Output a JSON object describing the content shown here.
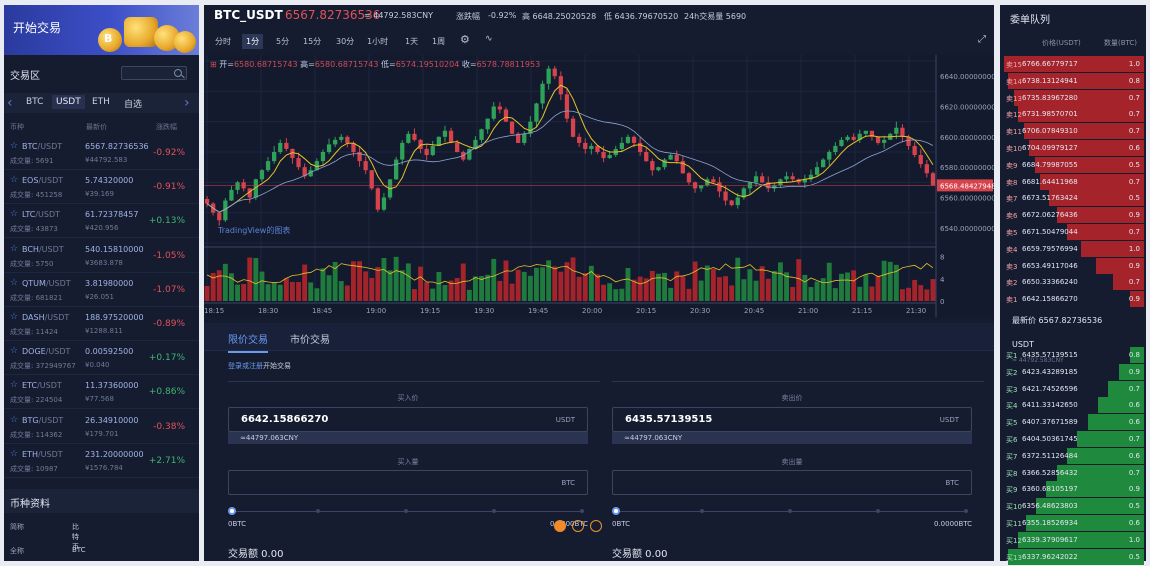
{
  "banner": {
    "button_label": "开始交易",
    "coin_text": "B"
  },
  "market": {
    "title": "交易区",
    "search_placeholder": "",
    "tabs": [
      "BTC",
      "USDT",
      "ETH",
      "自选"
    ],
    "active_tab": "USDT",
    "columns": [
      "币种",
      "最新价",
      "涨跌幅"
    ],
    "rows": [
      {
        "base": "BTC",
        "quote": "/USDT",
        "volume": "成交量: 5691",
        "price": "6567.82736536",
        "cny": "¥44792.583",
        "change": "-0.92%",
        "dir": "down"
      },
      {
        "base": "EOS",
        "quote": "/USDT",
        "volume": "成交量: 451258",
        "price": "5.74320000",
        "cny": "¥39.169",
        "change": "-0.91%",
        "dir": "down"
      },
      {
        "base": "LTC",
        "quote": "/USDT",
        "volume": "成交量: 43873",
        "price": "61.72378457",
        "cny": "¥420.956",
        "change": "+0.13%",
        "dir": "up"
      },
      {
        "base": "BCH",
        "quote": "/USDT",
        "volume": "成交量: 5750",
        "price": "540.15810000",
        "cny": "¥3683.878",
        "change": "-1.05%",
        "dir": "down"
      },
      {
        "base": "QTUM",
        "quote": "/USDT",
        "volume": "成交量: 681821",
        "price": "3.81980000",
        "cny": "¥26.051",
        "change": "-1.07%",
        "dir": "down"
      },
      {
        "base": "DASH",
        "quote": "/USDT",
        "volume": "成交量: 11424",
        "price": "188.97520000",
        "cny": "¥1288.811",
        "change": "-0.89%",
        "dir": "down"
      },
      {
        "base": "DOGE",
        "quote": "/USDT",
        "volume": "成交量: 372949767",
        "price": "0.00592500",
        "cny": "¥0.040",
        "change": "+0.17%",
        "dir": "up"
      },
      {
        "base": "ETC",
        "quote": "/USDT",
        "volume": "成交量: 224504",
        "price": "11.37360000",
        "cny": "¥77.568",
        "change": "+0.86%",
        "dir": "up"
      },
      {
        "base": "BTG",
        "quote": "/USDT",
        "volume": "成交量: 114362",
        "price": "26.34910000",
        "cny": "¥179.701",
        "change": "-0.38%",
        "dir": "down"
      },
      {
        "base": "ETH",
        "quote": "/USDT",
        "volume": "成交量: 10987",
        "price": "231.20000000",
        "cny": "¥1576.784",
        "change": "+2.71%",
        "dir": "up"
      }
    ]
  },
  "coin_info": {
    "title": "币种资料",
    "rows": [
      {
        "label": "简称",
        "value": "比特币"
      },
      {
        "label": "全称",
        "value": "BTC"
      }
    ]
  },
  "header": {
    "symbol": "BTC_USDT",
    "last_price": "6567.82736536",
    "cny": "≈ 44792.583CNY",
    "change_label": "涨跌幅",
    "change": "-0.92%",
    "high": "高 6648.25020528",
    "low": "低 6436.79670520",
    "volume": "24h交易量  5690"
  },
  "intervals": [
    "分时",
    "1分",
    "5分",
    "15分",
    "30分",
    "1小时",
    "1天",
    "1周"
  ],
  "selected_interval": "1分",
  "chart": {
    "ohlc_open_label": "开=",
    "open": "6580.68715743",
    "high_label": "高=",
    "high": "6580.68715743",
    "low_label": "低=",
    "low": "6574.19510204",
    "close_label": "收=",
    "close": "6578.78811953",
    "watermark": "TradingView的图表",
    "price_ticks": [
      "6640.00000000",
      "6620.00000000",
      "6600.00000000",
      "6580.00000000",
      "6560.00000000",
      "6540.00000000"
    ],
    "last_tag": "6568.48427948",
    "volume_ticks": [
      "8",
      "4",
      "0"
    ],
    "time_ticks": [
      "18:15",
      "18:30",
      "18:45",
      "19:00",
      "19:15",
      "19:30",
      "19:45",
      "20:00",
      "20:15",
      "20:30",
      "20:45",
      "21:00",
      "21:15",
      "21:30"
    ]
  },
  "chart_data": {
    "type": "candlestick",
    "price_range": [
      6530,
      6650
    ],
    "volume_range": [
      0,
      9
    ],
    "close_path": [
      6556,
      6550,
      6545,
      6558,
      6565,
      6570,
      6566,
      6560,
      6572,
      6578,
      6584,
      6590,
      6596,
      6592,
      6586,
      6580,
      6574,
      6578,
      6584,
      6590,
      6595,
      6598,
      6600,
      6596,
      6590,
      6584,
      6578,
      6566,
      6552,
      6560,
      6572,
      6585,
      6596,
      6602,
      6598,
      6592,
      6588,
      6594,
      6600,
      6604,
      6596,
      6590,
      6585,
      6592,
      6598,
      6605,
      6612,
      6620,
      6618,
      6610,
      6602,
      6596,
      6602,
      6610,
      6622,
      6635,
      6645,
      6640,
      6628,
      6612,
      6600,
      6596,
      6592,
      6594,
      6590,
      6586,
      6588,
      6592,
      6596,
      6600,
      6596,
      6590,
      6584,
      6578,
      6580,
      6585,
      6588,
      6584,
      6576,
      6570,
      6566,
      6568,
      6572,
      6570,
      6564,
      6558,
      6555,
      6560,
      6566,
      6570,
      6574,
      6570,
      6566,
      6568,
      6572,
      6574,
      6572,
      6570,
      6572,
      6575,
      6580,
      6585,
      6590,
      6594,
      6598,
      6600,
      6598,
      6602,
      6604,
      6600,
      6596,
      6598,
      6602,
      6606,
      6600,
      6594,
      6588,
      6582,
      6576,
      6568
    ]
  },
  "form": {
    "tabs": [
      "限价交易",
      "市价交易"
    ],
    "active_tab": "限价交易",
    "login_link": "登录或注册",
    "login_suffix": "开始交易",
    "buy": {
      "price_label": "买入价",
      "price": "6642.15866270",
      "price_unit": "USDT",
      "price_cny": "≈44797.063CNY",
      "qty_label": "买入量",
      "qty_unit": "BTC",
      "min": "0BTC",
      "max": "0.0000BTC",
      "amount_label": "交易额 0.00"
    },
    "sell": {
      "price_label": "卖出价",
      "price": "6435.57139515",
      "price_unit": "USDT",
      "price_cny": "≈44797.063CNY",
      "qty_label": "卖出量",
      "qty_unit": "BTC",
      "min": "0BTC",
      "max": "0.0000BTC",
      "amount_label": "交易额 0.00"
    }
  },
  "orderbook": {
    "title": "委单队列",
    "col_price": "价格(USDT)",
    "col_amount": "数量(BTC)",
    "asks": [
      {
        "label": "卖15",
        "price": "6766.66779717",
        "amount": "1.0",
        "depth": 1.0
      },
      {
        "label": "卖14",
        "price": "6738.13124941",
        "amount": "0.8",
        "depth": 0.97
      },
      {
        "label": "卖13",
        "price": "6735.83967280",
        "amount": "0.7",
        "depth": 0.93
      },
      {
        "label": "卖12",
        "price": "6731.98570701",
        "amount": "0.7",
        "depth": 0.9
      },
      {
        "label": "卖11",
        "price": "6706.07849310",
        "amount": "0.7",
        "depth": 0.86
      },
      {
        "label": "卖10",
        "price": "6704.09979127",
        "amount": "0.6",
        "depth": 0.82
      },
      {
        "label": "卖9",
        "price": "6684.79987055",
        "amount": "0.5",
        "depth": 0.78
      },
      {
        "label": "卖8",
        "price": "6681.64411968",
        "amount": "0.7",
        "depth": 0.74
      },
      {
        "label": "卖7",
        "price": "6673.51763424",
        "amount": "0.5",
        "depth": 0.68
      },
      {
        "label": "卖6",
        "price": "6672.06276436",
        "amount": "0.9",
        "depth": 0.62
      },
      {
        "label": "卖5",
        "price": "6671.50479044",
        "amount": "0.7",
        "depth": 0.55
      },
      {
        "label": "卖4",
        "price": "6659.79576994",
        "amount": "1.0",
        "depth": 0.45
      },
      {
        "label": "卖3",
        "price": "6653.49117046",
        "amount": "0.9",
        "depth": 0.34
      },
      {
        "label": "卖2",
        "price": "6650.33366240",
        "amount": "0.7",
        "depth": 0.22
      },
      {
        "label": "卖1",
        "price": "6642.15866270",
        "amount": "0.9",
        "depth": 0.1
      }
    ],
    "latest_label": "最新价",
    "latest": "6567.82736536",
    "usdt_label": "USDT",
    "usdt_cny": "≈ 44792.583CNY",
    "bids": [
      {
        "label": "买1",
        "price": "6435.57139515",
        "amount": "0.8",
        "depth": 0.1
      },
      {
        "label": "买2",
        "price": "6423.43289185",
        "amount": "0.9",
        "depth": 0.18
      },
      {
        "label": "买3",
        "price": "6421.74526596",
        "amount": "0.7",
        "depth": 0.26
      },
      {
        "label": "买4",
        "price": "6411.33142650",
        "amount": "0.6",
        "depth": 0.33
      },
      {
        "label": "买5",
        "price": "6407.37671589",
        "amount": "0.6",
        "depth": 0.4
      },
      {
        "label": "买6",
        "price": "6404.50361745",
        "amount": "0.7",
        "depth": 0.48
      },
      {
        "label": "买7",
        "price": "6372.51126484",
        "amount": "0.6",
        "depth": 0.55
      },
      {
        "label": "买8",
        "price": "6366.52856432",
        "amount": "0.7",
        "depth": 0.62
      },
      {
        "label": "买9",
        "price": "6360.68105197",
        "amount": "0.9",
        "depth": 0.7
      },
      {
        "label": "买10",
        "price": "6356.48623803",
        "amount": "0.5",
        "depth": 0.77
      },
      {
        "label": "买11",
        "price": "6355.18526934",
        "amount": "0.6",
        "depth": 0.84
      },
      {
        "label": "买12",
        "price": "6339.37909617",
        "amount": "1.0",
        "depth": 0.9
      },
      {
        "label": "买13",
        "price": "6337.96242022",
        "amount": "0.5",
        "depth": 0.97
      }
    ]
  }
}
